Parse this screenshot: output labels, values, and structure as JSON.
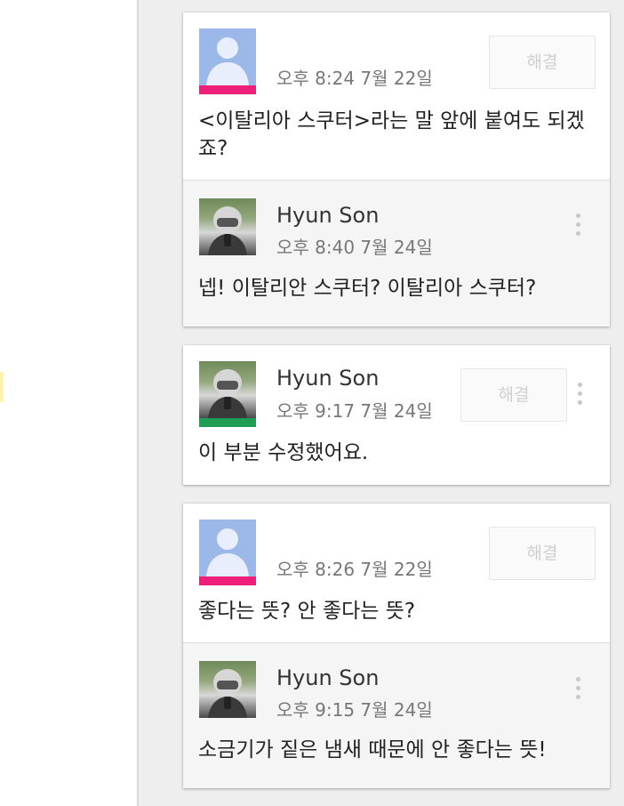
{
  "threads": [
    {
      "resolve_label": "해결",
      "comments": [
        {
          "author": "",
          "timestamp": "오후 8:24 7월 22일",
          "text": "<이탈리아 스쿠터>라는 말 앞에 붙여도 되겠죠?",
          "avatar": "default-avatar-icon",
          "color_bar": "#ee1f78"
        },
        {
          "author": "Hyun Son",
          "timestamp": "오후 8:40 7월 24일",
          "text": "넵! 이탈리안 스쿠터? 이탈리아 스쿠터?",
          "avatar": "photo"
        }
      ]
    },
    {
      "resolve_label": "해결",
      "comments": [
        {
          "author": "Hyun Son",
          "timestamp": "오후 9:17 7월 24일",
          "text": "이 부분 수정했어요.",
          "avatar": "photo",
          "color_bar": "#1f9d55"
        }
      ]
    },
    {
      "resolve_label": "해결",
      "comments": [
        {
          "author": "",
          "timestamp": "오후 8:26 7월 22일",
          "text": "좋다는 뜻? 안 좋다는 뜻?",
          "avatar": "default-avatar-icon",
          "color_bar": "#ee1f78"
        },
        {
          "author": "Hyun Son",
          "timestamp": "오후 9:15 7월 24일",
          "text": "소금기가 짙은 냄새 때문에 안 좋다는 뜻!",
          "avatar": "photo"
        }
      ]
    }
  ],
  "icons": {
    "more": "more-vert-icon",
    "default_avatar": "default-avatar-icon"
  }
}
